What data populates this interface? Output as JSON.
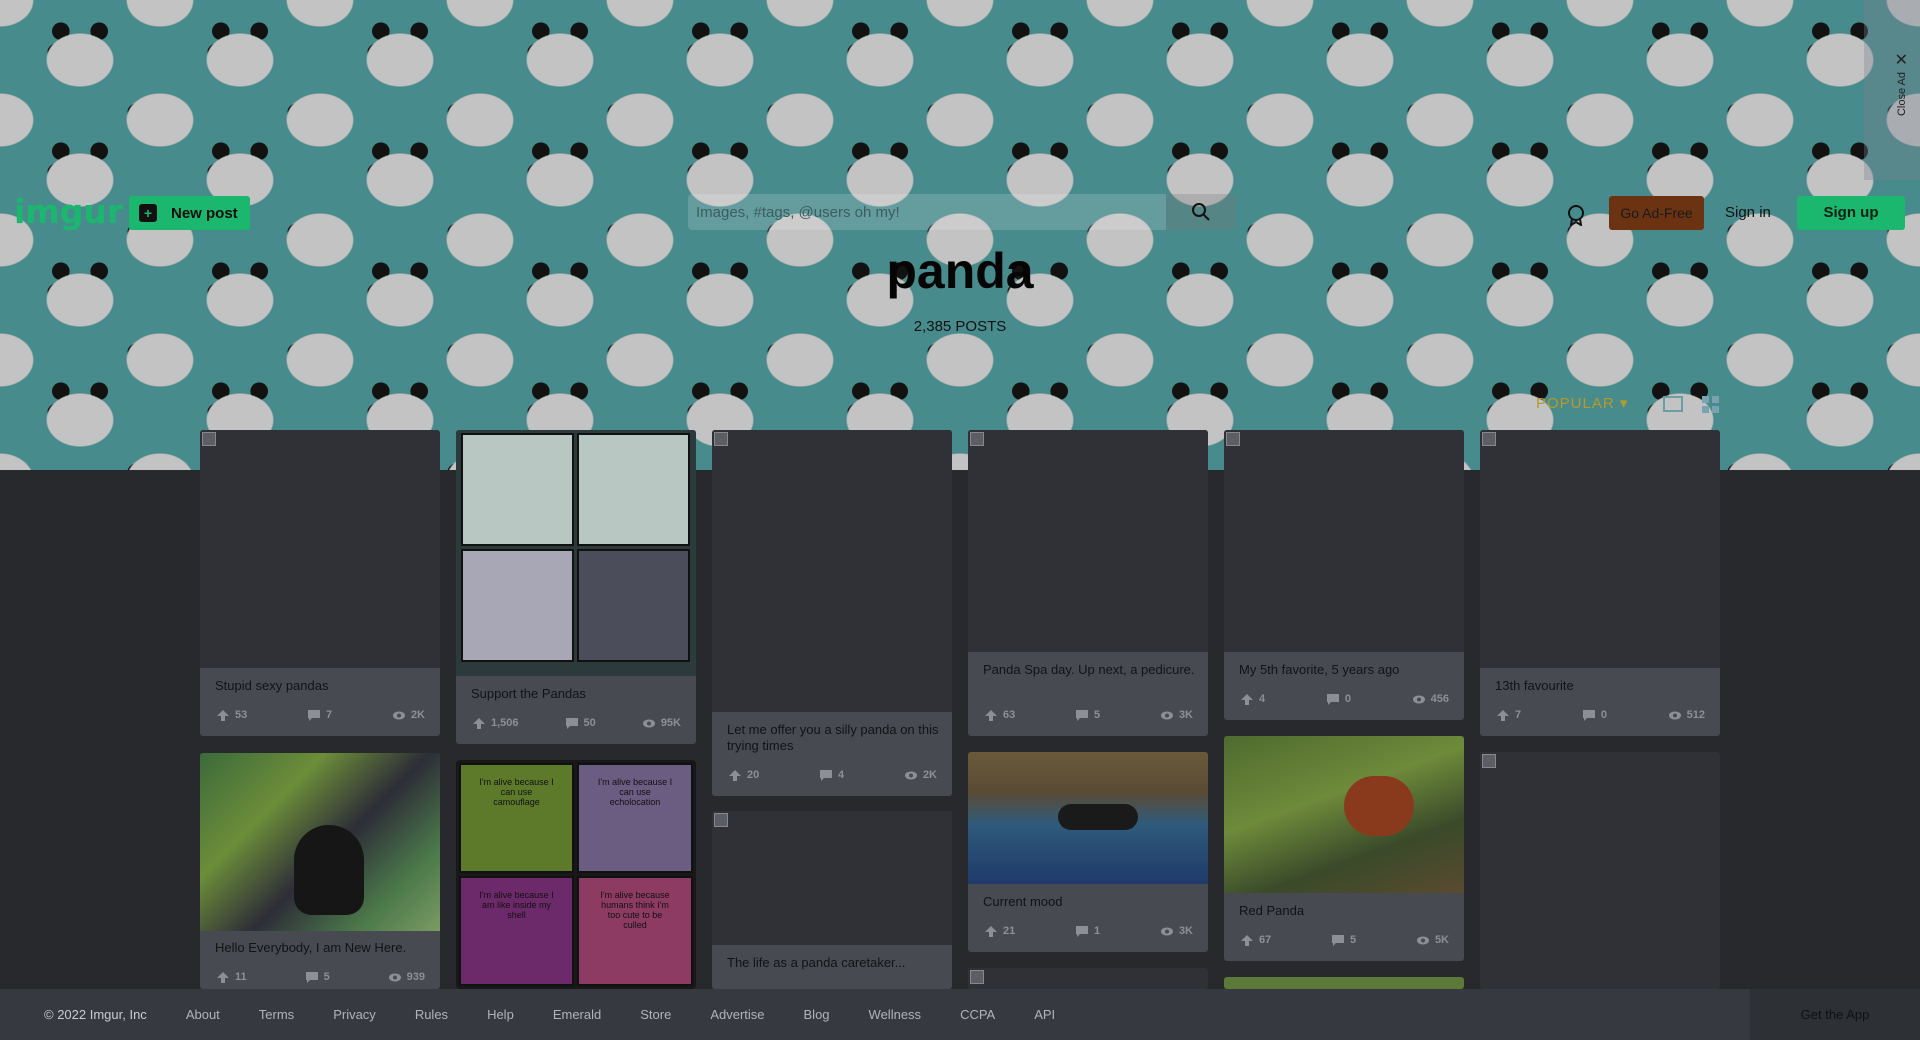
{
  "header": {
    "logo": "imgur",
    "new_post": "New post",
    "search_placeholder": "Images, #tags, @users oh my!",
    "go_ad_free": "Go Ad-Free",
    "sign_in": "Sign in",
    "sign_up": "Sign up",
    "close_ad": "Close Ad"
  },
  "tag": {
    "title": "panda",
    "count": "2,385 POSTS",
    "sort": "POPULAR ▾"
  },
  "posts": [
    {
      "title": "Stupid sexy pandas",
      "upvotes": "53",
      "comments": "7",
      "views": "2K"
    },
    {
      "title": "Support the Pandas",
      "upvotes": "1,506",
      "comments": "50",
      "views": "95K"
    },
    {
      "title": "Let me offer you a silly panda on this trying times",
      "upvotes": "20",
      "comments": "4",
      "views": "2K"
    },
    {
      "title": "Panda Spa day. Up next, a pedicure.",
      "upvotes": "63",
      "comments": "5",
      "views": "3K"
    },
    {
      "title": "My 5th favorite, 5 years ago",
      "upvotes": "4",
      "comments": "0",
      "views": "456"
    },
    {
      "title": "13th favourite",
      "upvotes": "7",
      "comments": "0",
      "views": "512"
    },
    {
      "title": "Hello Everybody, I am New Here.",
      "upvotes": "11",
      "comments": "5",
      "views": "939"
    },
    {
      "title": "The life as a panda caretaker...",
      "upvotes": "",
      "comments": "",
      "views": ""
    },
    {
      "title": "Current mood",
      "upvotes": "21",
      "comments": "1",
      "views": "3K"
    },
    {
      "title": "Red Panda",
      "upvotes": "67",
      "comments": "5",
      "views": "5K"
    }
  ],
  "comic_text": {
    "c1": "I'm alive because I can use camouflage",
    "c2": "I'm alive because I can use echolocation",
    "c3": "I'm alive because I am like inside my shell",
    "c4": "I'm alive because humans think I'm too cute to be culled"
  },
  "footer": {
    "copyright": "© 2022 Imgur, Inc",
    "links": [
      "About",
      "Terms",
      "Privacy",
      "Rules",
      "Help",
      "Emerald",
      "Store",
      "Advertise",
      "Blog",
      "Wellness",
      "CCPA",
      "API"
    ],
    "get_app": "Get the App"
  },
  "colors": {
    "brand_green": "#1bb76e",
    "banner_teal": "#4f9798",
    "page_bg": "#27292d",
    "card_bg": "#474a51",
    "ad_free_brown": "#6b3312"
  }
}
